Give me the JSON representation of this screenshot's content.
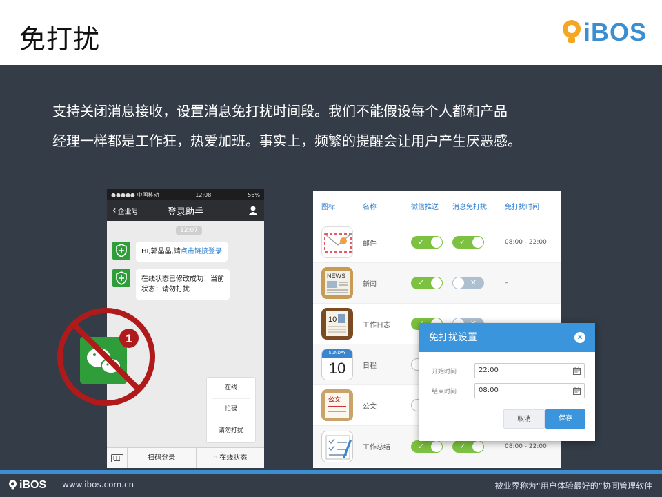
{
  "header": {
    "title": "免打扰",
    "brand": "iBOS"
  },
  "description": {
    "line1": "支持关闭消息接收，设置消息免打扰时间段。我们不能假设每个人都和产品",
    "line2": "经理一样都是工作狂，热爱加班。事实上，频繁的提醒会让用户产生厌恶感。"
  },
  "phone": {
    "status": {
      "carrier": "●●●●● 中国移动",
      "time": "12:08",
      "battery": "56%"
    },
    "nav": {
      "back_label": "企业号",
      "title": "登录助手"
    },
    "time_pill": "12:07",
    "messages": [
      {
        "text_prefix": "HI,郭晶晶,请",
        "link": "点击链接登录"
      },
      {
        "line1": "在线状态已修改成功！当前",
        "line2": "状态：请勿打扰"
      }
    ],
    "popup_menu": [
      "在线",
      "忙碌",
      "请勿打扰"
    ],
    "bottom_bar": {
      "scan": "扫码登录",
      "status": "在线状态"
    },
    "badge_count": "1"
  },
  "settings_table": {
    "headers": [
      "图标",
      "名称",
      "微信推送",
      "消息免打扰",
      "免打扰时间"
    ],
    "rows": [
      {
        "name": "邮件",
        "icon": "mail-icon",
        "wechat_push": true,
        "dnd": true,
        "time": "08:00 - 22:00"
      },
      {
        "name": "新闻",
        "icon": "news-icon",
        "wechat_push": true,
        "dnd": false,
        "time": "–"
      },
      {
        "name": "工作日志",
        "icon": "diary-icon",
        "wechat_push": true,
        "dnd": false,
        "time": ""
      },
      {
        "name": "日程",
        "icon": "calendar-icon",
        "wechat_push": false,
        "dnd": false,
        "time": "",
        "calendar_month": "SUNDAY",
        "calendar_day": "10"
      },
      {
        "name": "公文",
        "icon": "document-icon",
        "wechat_push": false,
        "dnd": false,
        "time": "",
        "doc_label": "公文"
      },
      {
        "name": "工作总结",
        "icon": "report-icon",
        "wechat_push": true,
        "dnd": true,
        "time": "08:00 - 22:00"
      }
    ]
  },
  "modal": {
    "title": "免打扰设置",
    "start_label": "开始时间",
    "start_value": "22:00",
    "end_label": "结束时间",
    "end_value": "08:00",
    "cancel": "取消",
    "save": "保存"
  },
  "footer": {
    "brand": "iBOS",
    "url": "www.ibos.com.cn",
    "slogan": "被业界称为“用户体验最好的”协同管理软件"
  },
  "colors": {
    "accent": "#3a95dd",
    "toggle_on": "#7cc13f",
    "toggle_off": "#aebfd0",
    "background": "#333c47",
    "wechat_green": "#2e9d3a",
    "no_sign_red": "#b01a1a"
  }
}
